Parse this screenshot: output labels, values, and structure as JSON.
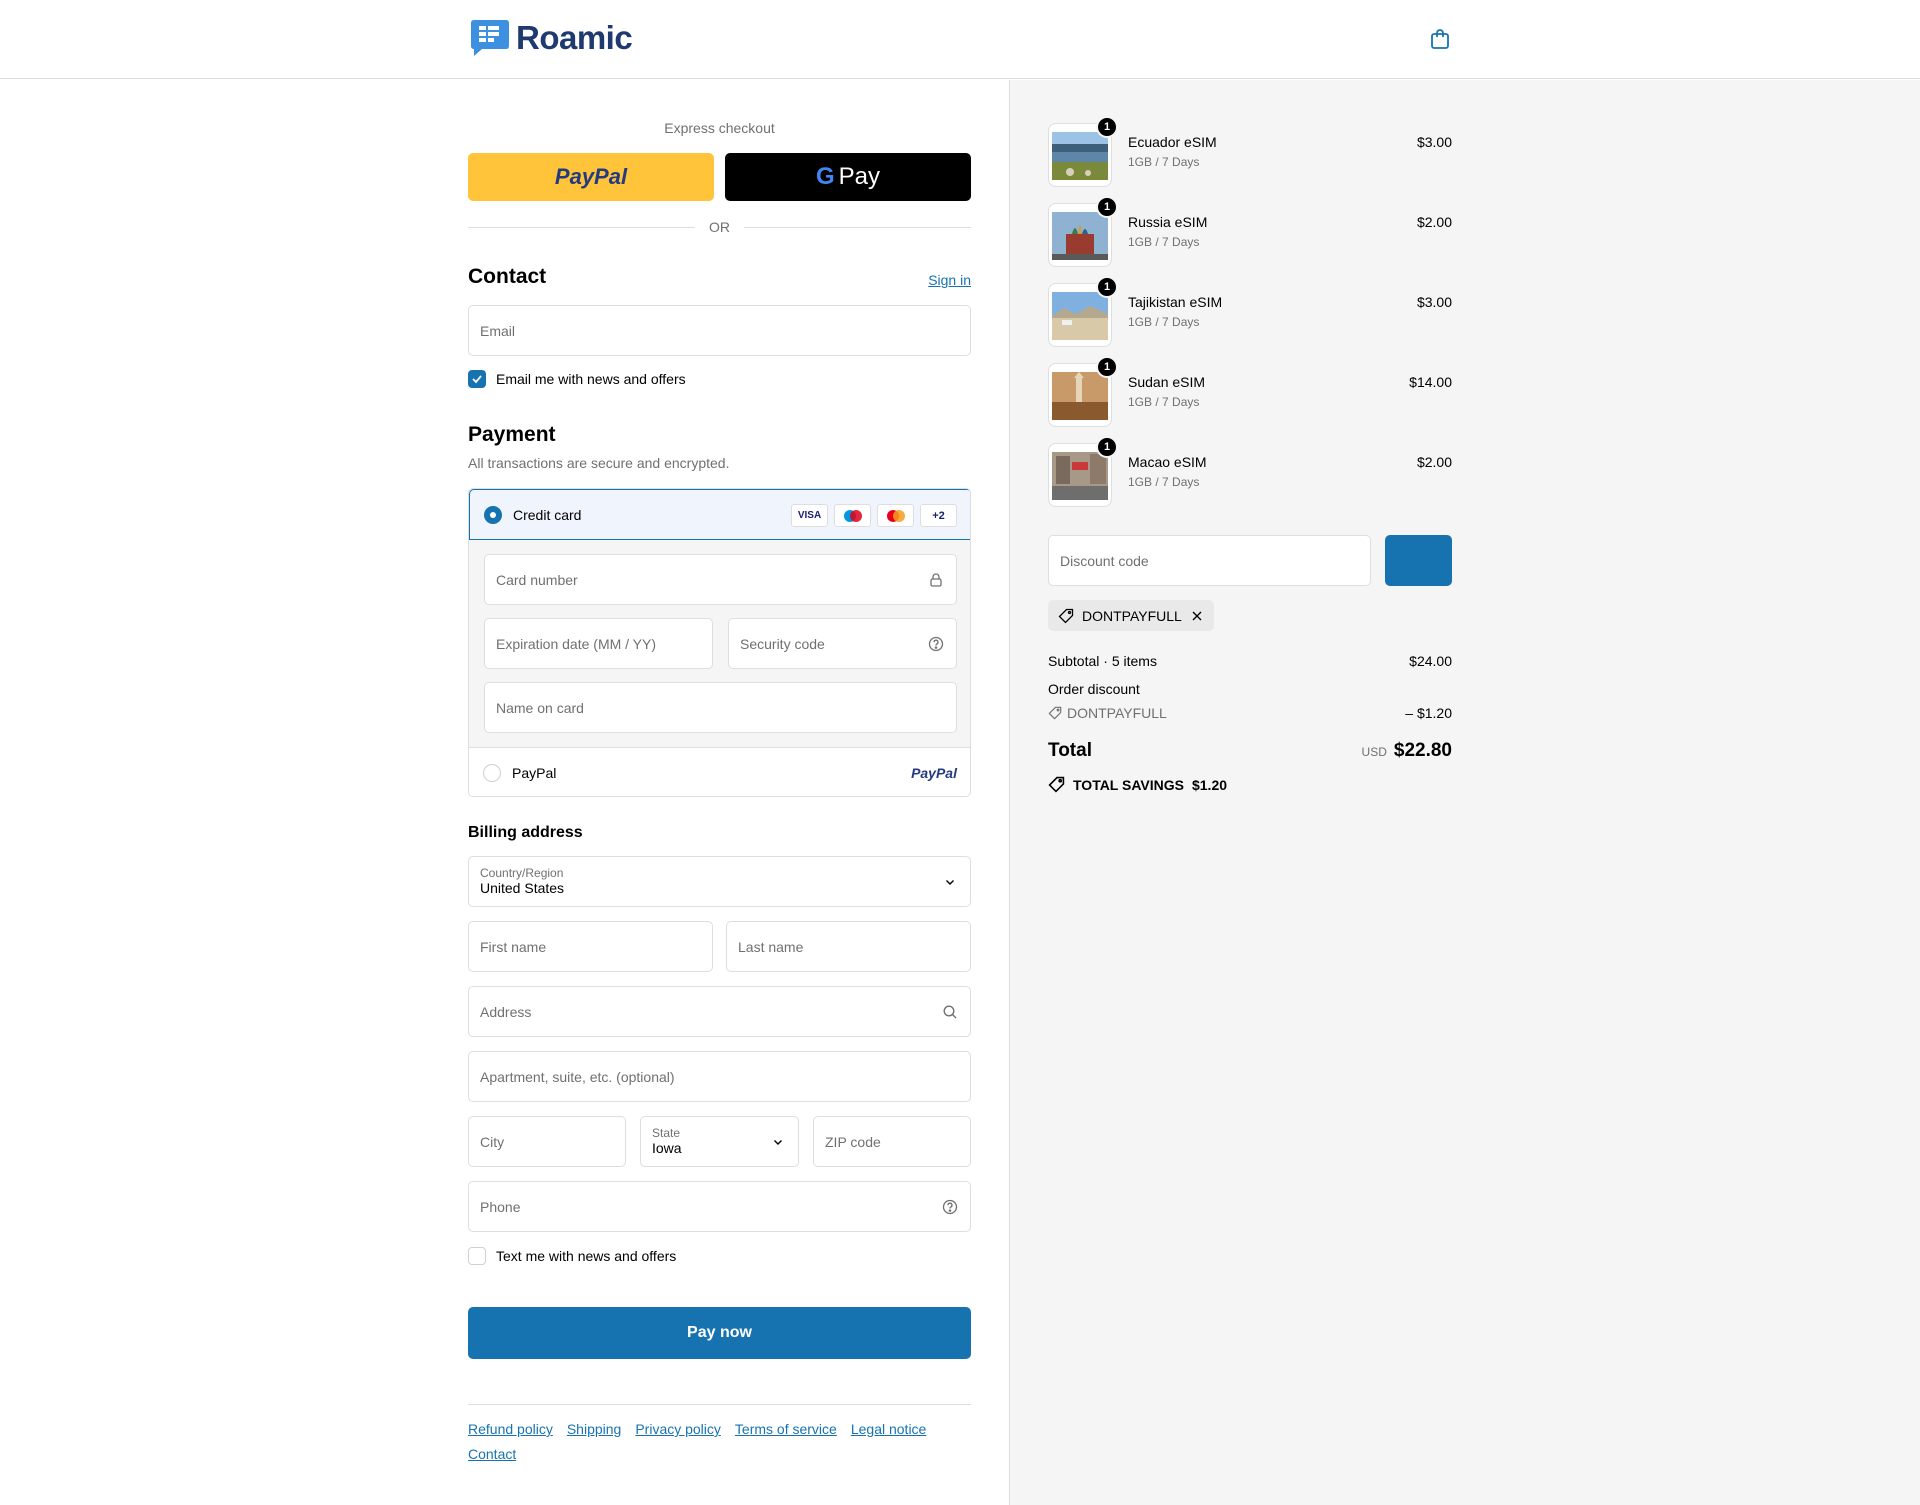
{
  "header": {
    "brand": "Roamic",
    "cart_icon": "shopping-bag-icon"
  },
  "express": {
    "title": "Express checkout",
    "paypal_label": "PayPal",
    "gpay_g": "G",
    "gpay_label": "Pay",
    "or_label": "OR"
  },
  "contact": {
    "title": "Contact",
    "signin_label": "Sign in",
    "email_placeholder": "Email",
    "news_checkbox_label": "Email me with news and offers",
    "news_checked": true
  },
  "payment": {
    "title": "Payment",
    "subtitle": "All transactions are secure and encrypted.",
    "credit_card_label": "Credit card",
    "card_badges": [
      "VISA",
      "",
      "",
      "+2"
    ],
    "card_number_placeholder": "Card number",
    "expiration_placeholder": "Expiration date (MM / YY)",
    "security_placeholder": "Security code",
    "name_placeholder": "Name on card",
    "paypal_option_label": "PayPal",
    "paypal_logo_text": "PayPal"
  },
  "billing": {
    "title": "Billing address",
    "country_label": "Country/Region",
    "country_value": "United States",
    "first_name_placeholder": "First name",
    "last_name_placeholder": "Last name",
    "address_placeholder": "Address",
    "apartment_placeholder": "Apartment, suite, etc. (optional)",
    "city_placeholder": "City",
    "state_label": "State",
    "state_value": "Iowa",
    "zip_placeholder": "ZIP code",
    "phone_placeholder": "Phone",
    "text_checkbox_label": "Text me with news and offers"
  },
  "pay_now_label": "Pay now",
  "footer_links": [
    "Refund policy",
    "Shipping",
    "Privacy policy",
    "Terms of service",
    "Legal notice",
    "Contact"
  ],
  "order": {
    "items": [
      {
        "name": "Ecuador eSIM",
        "variant": "1GB / 7 Days",
        "price": "$3.00",
        "qty": "1"
      },
      {
        "name": "Russia eSIM",
        "variant": "1GB / 7 Days",
        "price": "$2.00",
        "qty": "1"
      },
      {
        "name": "Tajikistan eSIM",
        "variant": "1GB / 7 Days",
        "price": "$3.00",
        "qty": "1"
      },
      {
        "name": "Sudan eSIM",
        "variant": "1GB / 7 Days",
        "price": "$14.00",
        "qty": "1"
      },
      {
        "name": "Macao eSIM",
        "variant": "1GB / 7 Days",
        "price": "$2.00",
        "qty": "1"
      }
    ],
    "discount_placeholder": "Discount code",
    "applied_code": "DONTPAYFULL",
    "subtotal_label": "Subtotal · 5 items",
    "subtotal_value": "$24.00",
    "order_discount_label": "Order discount",
    "discount_code_label": "DONTPAYFULL",
    "discount_value": "– $1.20",
    "total_label": "Total",
    "currency": "USD",
    "total_value": "$22.80",
    "savings_label": "TOTAL SAVINGS",
    "savings_value": "$1.20"
  },
  "colors": {
    "accent": "#1773b0",
    "paypal_yellow": "#ffc439",
    "brand_navy": "#1f3a6e"
  }
}
